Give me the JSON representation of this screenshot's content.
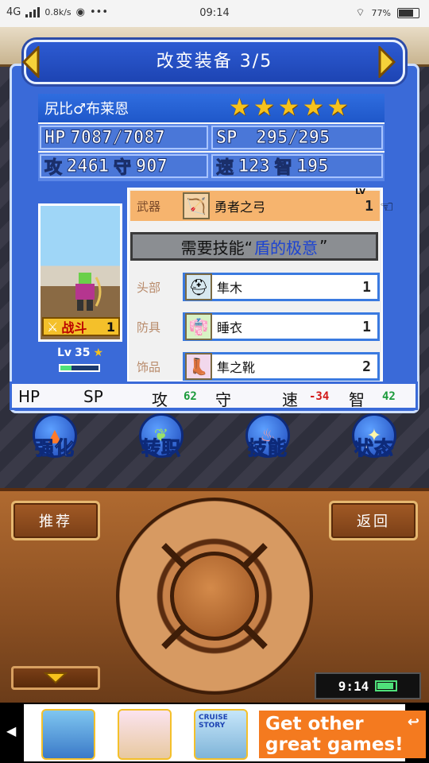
{
  "status_bar": {
    "network": "4G",
    "speed": "0.8k/s",
    "time": "09:14",
    "battery": "77"
  },
  "dialog": {
    "title": "改变装备 3/5",
    "prev_icon": "arrow-left-icon",
    "next_icon": "arrow-right-icon"
  },
  "character": {
    "name": "尻比♂布莱恩",
    "stars": 5,
    "hp_label": "HP",
    "hp_value": "7087/7087",
    "sp_label": "SP",
    "sp_value": "295/295",
    "atk_label": "攻",
    "atk_value": "2461",
    "def_label": "守",
    "def_value": "907",
    "spd_label": "速",
    "spd_value": "123",
    "int_label": "智",
    "int_value": "195",
    "job_tag": "战斗",
    "job_count": "1",
    "level_label": "Lv",
    "level": "35",
    "exp_progress": 0.3
  },
  "equipment": {
    "weapon": {
      "label": "武器",
      "name": "勇者之弓",
      "count": "1",
      "level_tag": "LV"
    },
    "skill_requirement": {
      "prefix": "需要技能“",
      "skill": "盾的极意",
      "suffix": "”"
    },
    "head": {
      "label": "头部",
      "name": "隼木",
      "count": "1"
    },
    "armor": {
      "label": "防具",
      "name": "睡衣",
      "count": "1"
    },
    "accessory": {
      "label": "饰品",
      "name": "隼之靴",
      "count": "2"
    }
  },
  "stat_diff": {
    "hp": "HP",
    "sp": "SP",
    "atk": "攻",
    "atk_diff": "62",
    "def": "守",
    "spd": "速",
    "spd_diff": "-34",
    "int": "智",
    "int_diff": "42"
  },
  "actions": [
    "强化",
    "转职",
    "技能",
    "状态"
  ],
  "controller": {
    "recommend_label": "推荐",
    "back_label": "返回",
    "clock": "9:14"
  },
  "ad": {
    "cta_line1": "Get other",
    "cta_line2": "great games!",
    "thumb_caption": "CRUISE STORY"
  }
}
